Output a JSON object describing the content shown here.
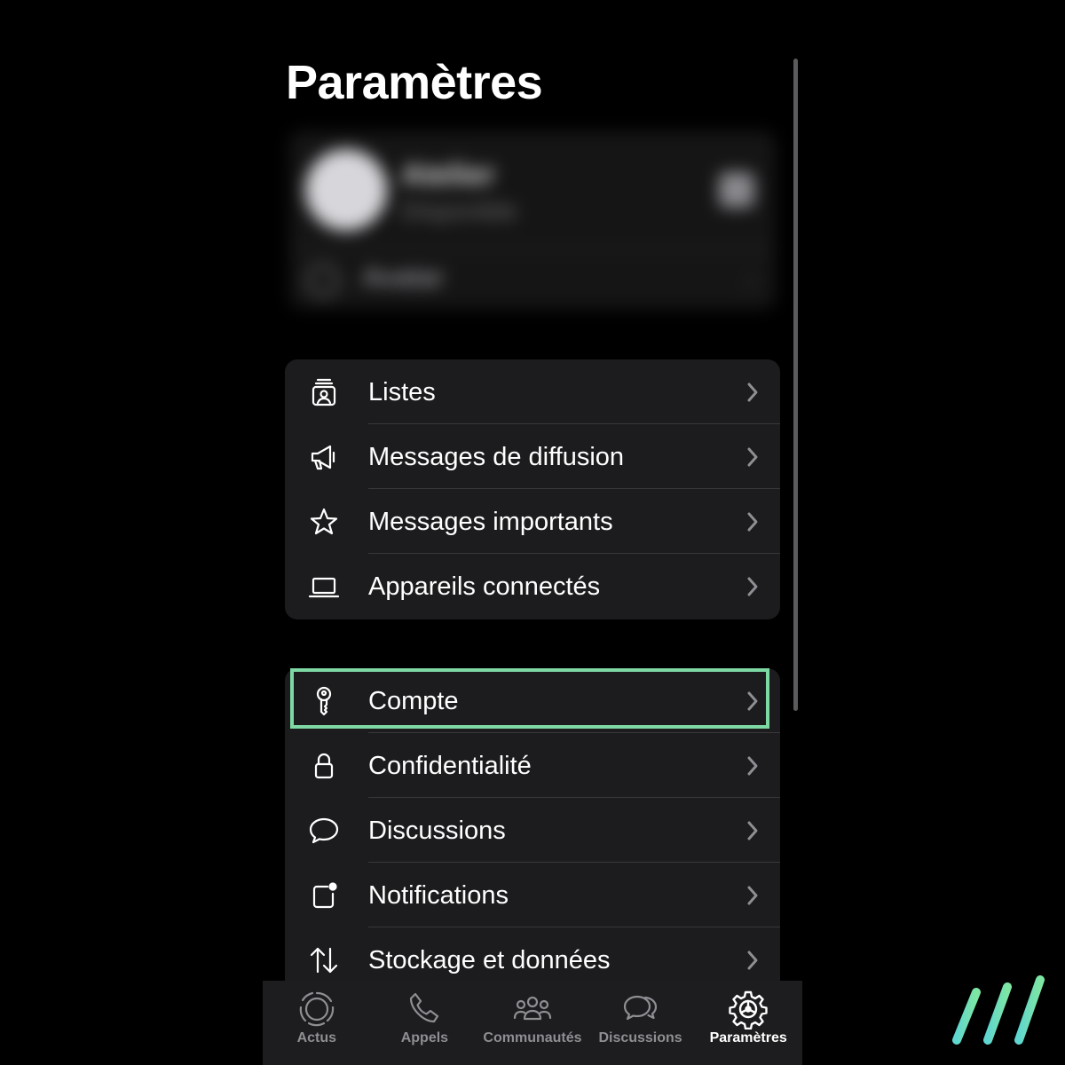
{
  "header": {
    "title": "Paramètres"
  },
  "profile": {
    "name": "Atelier",
    "status": "Disponible",
    "avatar_row_label": "Avatar"
  },
  "groups": {
    "tools": [
      {
        "label": "Listes",
        "icon": "contact-list-icon"
      },
      {
        "label": "Messages de diffusion",
        "icon": "megaphone-icon"
      },
      {
        "label": "Messages importants",
        "icon": "star-icon"
      },
      {
        "label": "Appareils connectés",
        "icon": "laptop-icon"
      }
    ],
    "settings": [
      {
        "label": "Compte",
        "icon": "key-icon",
        "highlighted": true
      },
      {
        "label": "Confidentialité",
        "icon": "lock-icon"
      },
      {
        "label": "Discussions",
        "icon": "chat-bubble-icon"
      },
      {
        "label": "Notifications",
        "icon": "notification-badge-icon"
      },
      {
        "label": "Stockage et données",
        "icon": "up-down-arrows-icon"
      }
    ]
  },
  "tab_bar": {
    "tabs": [
      {
        "label": "Actus",
        "icon": "status-ring-icon",
        "active": false
      },
      {
        "label": "Appels",
        "icon": "phone-icon",
        "active": false
      },
      {
        "label": "Communautés",
        "icon": "community-icon",
        "active": false
      },
      {
        "label": "Discussions",
        "icon": "chat-bubbles-icon",
        "active": false
      },
      {
        "label": "Paramètres",
        "icon": "gear-icon",
        "active": true
      }
    ]
  },
  "colors": {
    "background": "#000000",
    "group_background": "#1c1c1e",
    "highlight": "#7ed8a4",
    "inactive_tab": "#8e8e93",
    "active_tab": "#ffffff"
  }
}
